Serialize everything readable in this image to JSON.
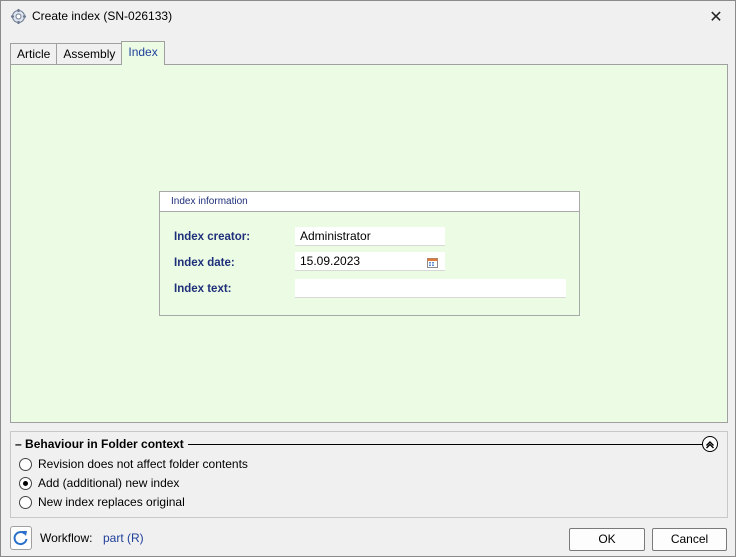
{
  "window": {
    "title": "Create index (SN-026133)",
    "close_glyph": "✕"
  },
  "tabs": [
    {
      "label": "Article"
    },
    {
      "label": "Assembly"
    },
    {
      "label": "Index"
    }
  ],
  "index_info": {
    "title": "Index information",
    "creator_label": "Index creator:",
    "creator_value": "Administrator",
    "date_label": "Index date:",
    "date_value": "15.09.2023",
    "text_label": "Index text:",
    "text_value": ""
  },
  "behaviour": {
    "title": "Behaviour in Folder context",
    "title_prefix": "–",
    "options": [
      {
        "label": "Revision does not affect folder contents",
        "checked": false
      },
      {
        "label": "Add (additional) new index",
        "checked": true
      },
      {
        "label": "New index replaces original",
        "checked": false
      }
    ]
  },
  "footer": {
    "workflow_label": "Workflow:",
    "workflow_value": "part (R)",
    "ok_label": "OK",
    "cancel_label": "Cancel"
  },
  "colors": {
    "panel_bg": "#ecfce4",
    "label_blue": "#1f2f7a",
    "link_blue": "#1f3f9a"
  },
  "icons": {
    "app": "gear-doc-icon",
    "close": "close-icon",
    "calendar": "calendar-icon",
    "collapse": "chevron-up-icon",
    "refresh": "refresh-icon"
  }
}
